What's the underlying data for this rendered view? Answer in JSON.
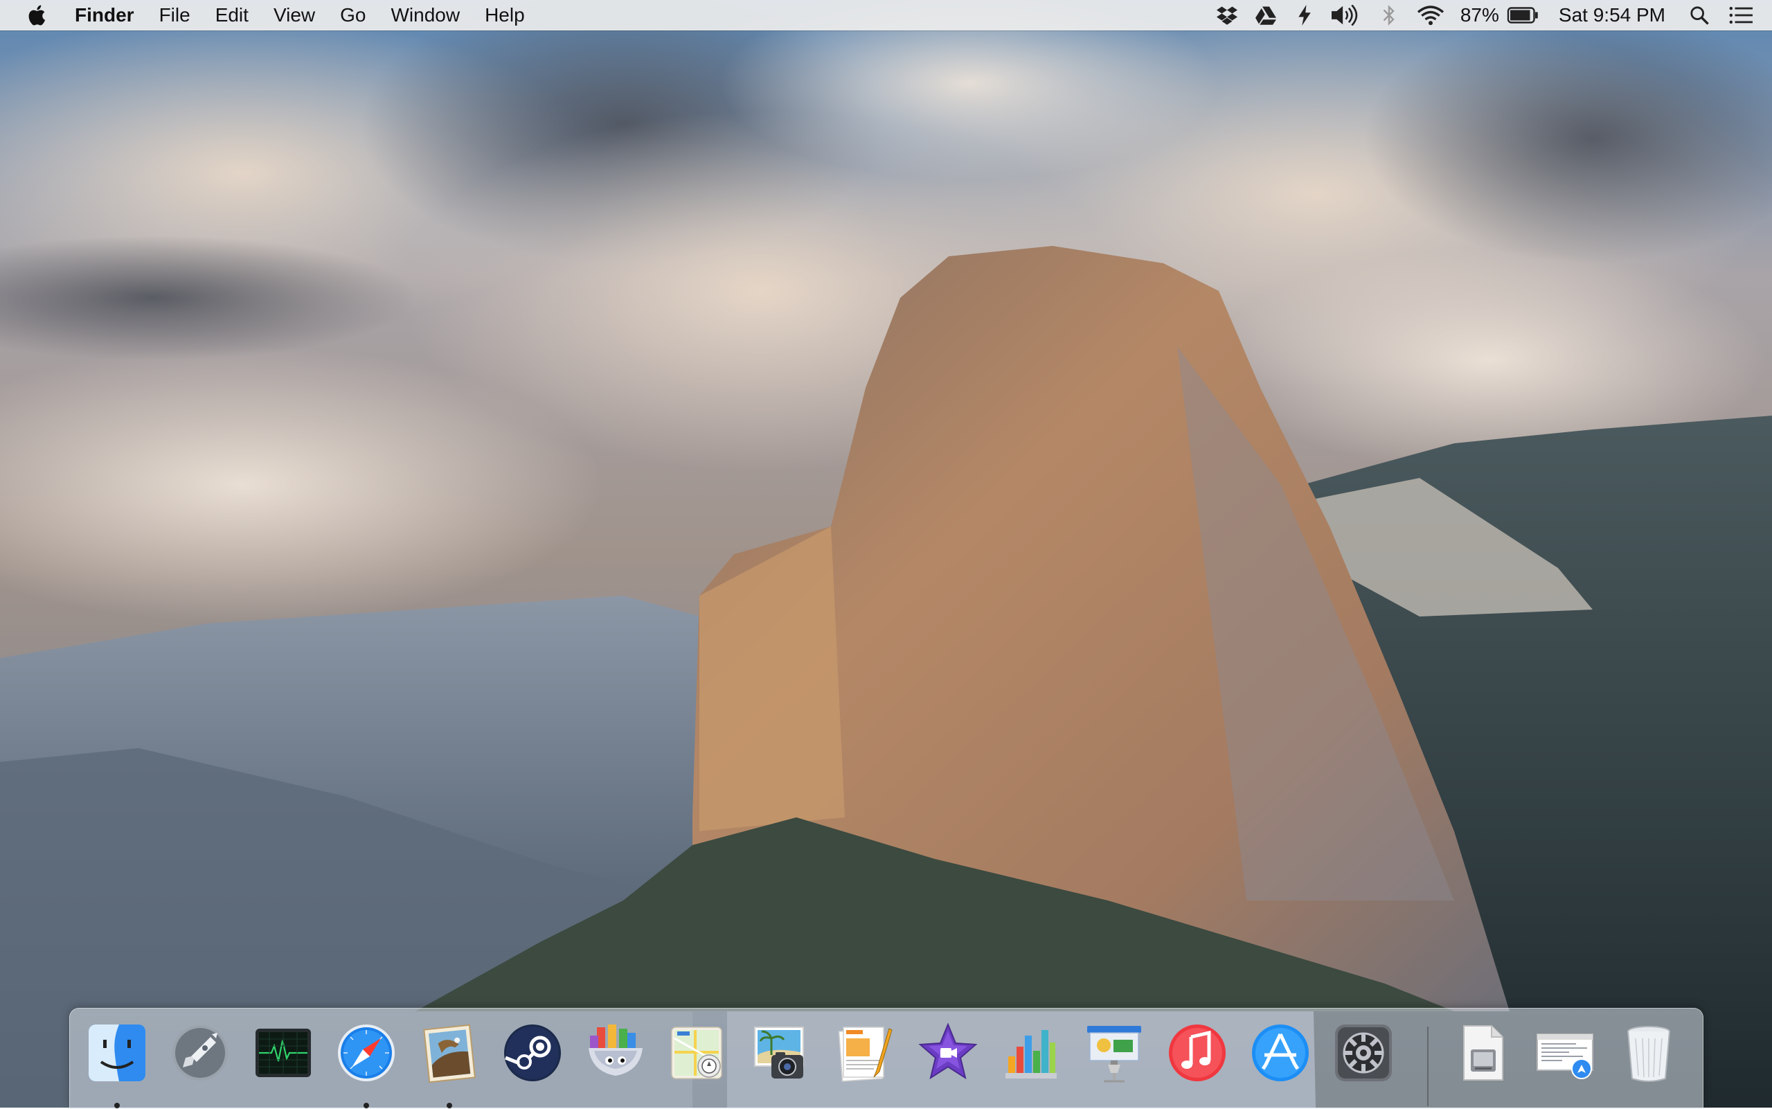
{
  "menubar": {
    "app_name": "Finder",
    "menus": [
      "File",
      "Edit",
      "View",
      "Go",
      "Window",
      "Help"
    ],
    "battery_percent": "87%",
    "clock": "Sat 9:54 PM",
    "status_icons": [
      "dropbox-icon",
      "google-drive-icon",
      "lightning-icon",
      "volume-icon",
      "bluetooth-icon",
      "wifi-icon",
      "battery-icon",
      "spotlight-search-icon",
      "notification-center-icon"
    ]
  },
  "dock": {
    "apps": [
      {
        "name": "finder",
        "running": true
      },
      {
        "name": "launchpad",
        "running": false
      },
      {
        "name": "activity-monitor",
        "running": false
      },
      {
        "name": "safari",
        "running": true
      },
      {
        "name": "mail",
        "running": true
      },
      {
        "name": "steam",
        "running": false
      },
      {
        "name": "candy-bar",
        "running": false
      },
      {
        "name": "maps",
        "running": false
      },
      {
        "name": "image-capture",
        "running": false
      },
      {
        "name": "pages",
        "running": false
      },
      {
        "name": "imovie",
        "running": false
      },
      {
        "name": "numbers",
        "running": false
      },
      {
        "name": "keynote",
        "running": false
      },
      {
        "name": "itunes",
        "running": false
      },
      {
        "name": "app-store",
        "running": false
      },
      {
        "name": "system-preferences",
        "running": false
      }
    ],
    "extras": [
      "documents-stack",
      "downloads-stack",
      "trash"
    ]
  },
  "colors": {
    "menubar_bg": "#ececec",
    "itunes_red": "#f0373f",
    "appstore_blue": "#1c8ef5",
    "safari_blue": "#1a7ee8",
    "steam_navy": "#1b2a4a"
  }
}
